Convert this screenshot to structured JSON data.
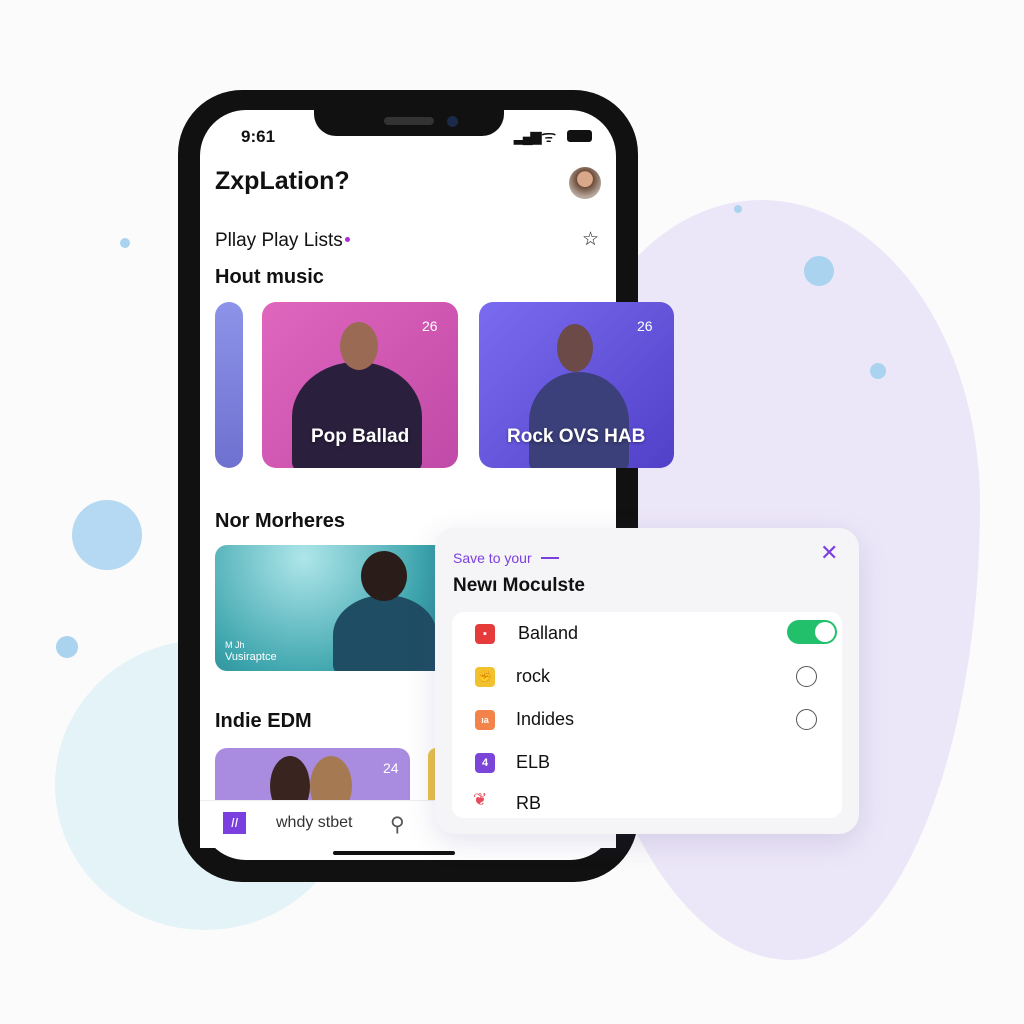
{
  "status_bar": {
    "time": "9:61"
  },
  "header": {
    "title": "ZxpLation?"
  },
  "section1": {
    "title": "Pllay Play Lists",
    "subtitle": "Hout music"
  },
  "cards": [
    {
      "label": "Pop Ballad",
      "count": "26",
      "color": "#d85cb4"
    },
    {
      "label": "Rock OVS HAB",
      "count": "26",
      "color": "#6a5ce0"
    }
  ],
  "section2": {
    "title": "Nor Morheres",
    "card_caption_1": "M  Jh",
    "card_caption_2": "Vusiraptce"
  },
  "section3": {
    "title": "Indie EDM",
    "card_count": "24"
  },
  "bottom_bar": {
    "label": "whdy stbet"
  },
  "modal": {
    "eyebrow": "Save to your",
    "title": "Newı Moculste",
    "items": [
      {
        "label": "Balland",
        "icon": "bookmark-icon",
        "color": "#e53b3b",
        "state": "toggle-on"
      },
      {
        "label": "rock",
        "icon": "fist-icon",
        "color": "#f2c12e",
        "state": "unchecked"
      },
      {
        "label": "Indides",
        "icon": "chart-icon",
        "color": "#f2834a",
        "state": "unchecked"
      },
      {
        "label": "ELB",
        "icon": "number-4-icon",
        "icon_text": "4",
        "color": "#7b45d9",
        "state": "none"
      },
      {
        "label": "RB",
        "icon": "heart-leaf-icon",
        "color": "#e94b5b",
        "state": "none"
      }
    ]
  },
  "colors": {
    "accent": "#7b3fe0",
    "toggle": "#22c06b"
  }
}
